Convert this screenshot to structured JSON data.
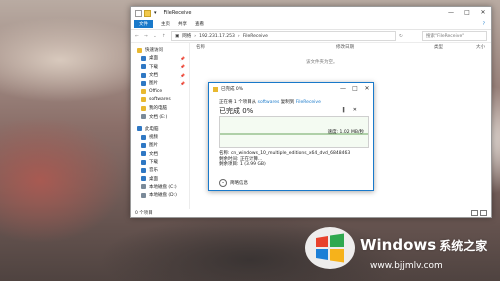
{
  "explorer": {
    "title": "FileReceive",
    "window_controls": [
      "—",
      "□",
      "✕"
    ],
    "ribbon_tabs": [
      "文件",
      "主页",
      "共享",
      "查看"
    ],
    "help": "?",
    "address_path": [
      "网络",
      "192.231.17.253",
      "FileReceive"
    ],
    "search_placeholder": "搜索\"FileReceive\"",
    "columns": [
      "名称",
      "修改日期",
      "类型",
      "大小"
    ],
    "empty_message": "该文件夹为空。",
    "status": "0 个项目",
    "sidebar": [
      {
        "label": "快速访问",
        "level": 0,
        "pin": false,
        "icon": "star-icon"
      },
      {
        "label": "桌面",
        "level": 1,
        "pin": true,
        "icon": "desktop-icon"
      },
      {
        "label": "下载",
        "level": 1,
        "pin": true,
        "icon": "download-icon"
      },
      {
        "label": "文档",
        "level": 1,
        "pin": true,
        "icon": "document-icon"
      },
      {
        "label": "图片",
        "level": 1,
        "pin": true,
        "icon": "picture-icon"
      },
      {
        "label": "Office",
        "level": 1,
        "pin": false,
        "icon": "folder-icon"
      },
      {
        "label": "softwares",
        "level": 1,
        "pin": false,
        "icon": "folder-icon"
      },
      {
        "label": "我的电脑",
        "level": 1,
        "pin": false,
        "icon": "folder-icon"
      },
      {
        "label": "文档 (E:)",
        "level": 1,
        "pin": false,
        "icon": "drive-icon"
      },
      {
        "label": "此电脑",
        "level": 0,
        "pin": false,
        "icon": "computer-icon"
      },
      {
        "label": "视频",
        "level": 1,
        "pin": false,
        "icon": "video-icon"
      },
      {
        "label": "图片",
        "level": 1,
        "pin": false,
        "icon": "picture-icon"
      },
      {
        "label": "文档",
        "level": 1,
        "pin": false,
        "icon": "document-icon"
      },
      {
        "label": "下载",
        "level": 1,
        "pin": false,
        "icon": "download-icon"
      },
      {
        "label": "音乐",
        "level": 1,
        "pin": false,
        "icon": "music-icon"
      },
      {
        "label": "桌面",
        "level": 1,
        "pin": false,
        "icon": "desktop-icon"
      },
      {
        "label": "本地磁盘 (C:)",
        "level": 1,
        "pin": false,
        "icon": "drive-icon"
      },
      {
        "label": "本地磁盘 (D:)",
        "level": 1,
        "pin": false,
        "icon": "drive-icon"
      }
    ]
  },
  "copy_dialog": {
    "title": "已完成 0%",
    "line_prefix": "正在将 1 个项目从",
    "line_source": "softwares",
    "line_middle": "复制到",
    "line_dest": "FileReceive",
    "percent_text": "已完成 0%",
    "progress": 0.0,
    "speed": "速度: 1.02 MB/秒",
    "name": "名称: cn_windows_10_multiple_editions_x64_dvd_6848463",
    "time_left": "剩余时间: 正在计算...",
    "items_left": "剩余项目: 1 (3.99 GB)",
    "more_details": "简略信息",
    "pause_icon": "‖",
    "close_icon": "✕"
  },
  "watermark": {
    "brand": "Windows",
    "brand_cn": "系统之家",
    "url": "www.bjjmlv.com"
  }
}
